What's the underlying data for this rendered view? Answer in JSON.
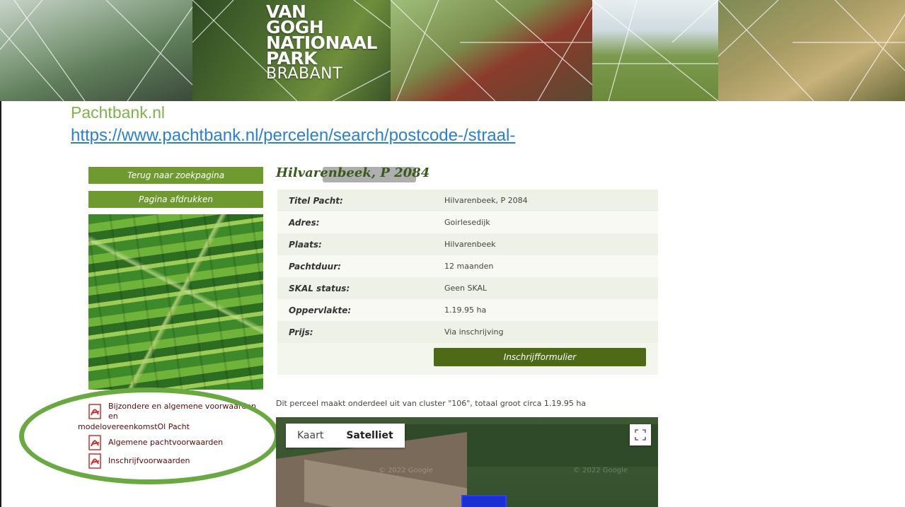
{
  "banner": {
    "park_name_lines": [
      "VAN",
      "GOGH",
      "NATIONAAL",
      "PARK"
    ],
    "park_region": "BRABANT"
  },
  "slide": {
    "title": "Pachtbank.nl",
    "url": " https://www.pachtbank.nl/percelen/search/postcode-/straal-"
  },
  "sidebar": {
    "back_button": "Terug naar zoekpagina",
    "print_button": "Pagina afdrukken",
    "documents": [
      {
        "label_line1": "Bijzondere en algemene voorwaarden en",
        "label_line2": "modelovereenkomstOl Pacht"
      },
      {
        "label": "Algemene pachtvoorwaarden"
      },
      {
        "label": "Inschrijfvoorwaarden"
      }
    ]
  },
  "parcel": {
    "heading": "Hilvarenbeek, P 2084",
    "details": [
      {
        "label": "Titel Pacht:",
        "value": "Hilvarenbeek, P 2084"
      },
      {
        "label": "Adres:",
        "value": "Goirlesedijk"
      },
      {
        "label": "Plaats:",
        "value": "Hilvarenbeek"
      },
      {
        "label": "Pachtduur:",
        "value": "12 maanden"
      },
      {
        "label": "SKAL status:",
        "value": "Geen SKAL"
      },
      {
        "label": "Oppervlakte:",
        "value": "1.19.95 ha"
      },
      {
        "label": "Prijs:",
        "value": "Via inschrijving"
      }
    ],
    "form_button": "Inschrijfformulier",
    "cluster_text": "Dit perceel maakt onderdeel uit van cluster \"106\", totaal groot circa 1.19.95 ha"
  },
  "map": {
    "tab_map": "Kaart",
    "tab_satellite": "Satelliet",
    "active_tab": "Satelliet",
    "watermark": "© 2022 Google"
  },
  "colors": {
    "accent_green": "#6f9a2f",
    "dark_green_button": "#4e6a17",
    "title_green": "#7fb24a",
    "link_blue": "#2b7fd3",
    "annotation_circle": "#6aa842"
  }
}
